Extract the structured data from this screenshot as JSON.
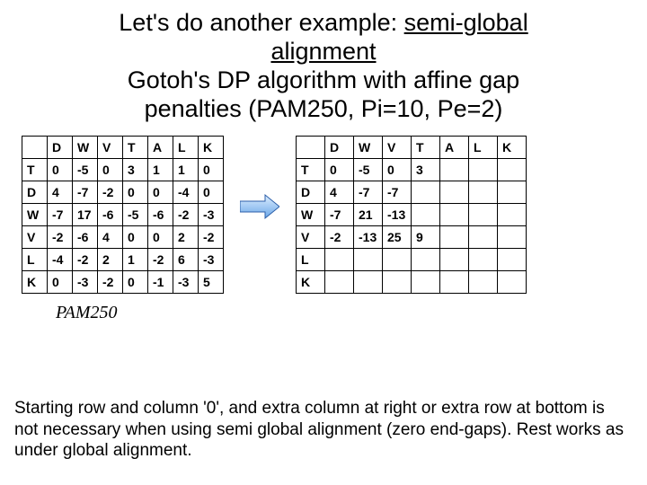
{
  "title": {
    "line1_pre": "Let's do another example: ",
    "line1_ul": "semi-global",
    "line2": "alignment",
    "line3": "Gotoh's DP algorithm with affine gap",
    "line4": "penalties (PAM250, Pi=10, Pe=2)"
  },
  "left_table": {
    "col_headers": [
      "D",
      "W",
      "V",
      "T",
      "A",
      "L",
      "K"
    ],
    "rows": [
      {
        "h": "T",
        "cells": [
          "0",
          "-5",
          "0",
          "3",
          "1",
          "1",
          "0"
        ]
      },
      {
        "h": "D",
        "cells": [
          "4",
          "-7",
          "-2",
          "0",
          "0",
          "-4",
          "0"
        ]
      },
      {
        "h": "W",
        "cells": [
          "-7",
          "17",
          "-6",
          "-5",
          "-6",
          "-2",
          "-3"
        ]
      },
      {
        "h": "V",
        "cells": [
          "-2",
          "-6",
          "4",
          "0",
          "0",
          "2",
          "-2"
        ]
      },
      {
        "h": "L",
        "cells": [
          "-4",
          "-2",
          "2",
          "1",
          "-2",
          "6",
          "-3"
        ]
      },
      {
        "h": "K",
        "cells": [
          "0",
          "-3",
          "-2",
          "0",
          "-1",
          "-3",
          "5"
        ]
      }
    ]
  },
  "right_table": {
    "col_headers": [
      "D",
      "W",
      "V",
      "T",
      "A",
      "L",
      "K"
    ],
    "rows": [
      {
        "h": "T",
        "cells": [
          "0",
          "-5",
          "0",
          "3",
          "",
          "",
          ""
        ]
      },
      {
        "h": "D",
        "cells": [
          "4",
          "-7",
          "-7",
          "",
          "",
          "",
          ""
        ]
      },
      {
        "h": "W",
        "cells": [
          "-7",
          "21",
          "-13",
          "",
          "",
          "",
          ""
        ]
      },
      {
        "h": "V",
        "cells": [
          "-2",
          "-13",
          "25",
          "9",
          "",
          "",
          ""
        ]
      },
      {
        "h": "L",
        "cells": [
          "",
          "",
          "",
          "",
          "",
          "",
          ""
        ]
      },
      {
        "h": "K",
        "cells": [
          "",
          "",
          "",
          "",
          "",
          "",
          ""
        ]
      }
    ]
  },
  "caption": "PAM250",
  "footer": "Starting row and column '0', and extra column at right or extra row at bottom is not necessary when using semi global alignment (zero end-gaps). Rest works as under global alignment.",
  "chart_data": [
    {
      "type": "table",
      "title": "PAM250 substitution scores (left matrix)",
      "columns": [
        "",
        "D",
        "W",
        "V",
        "T",
        "A",
        "L",
        "K"
      ],
      "rows": [
        [
          "T",
          0,
          -5,
          0,
          3,
          1,
          1,
          0
        ],
        [
          "D",
          4,
          -7,
          -2,
          0,
          0,
          -4,
          0
        ],
        [
          "W",
          -7,
          17,
          -6,
          -5,
          -6,
          -2,
          -3
        ],
        [
          "V",
          -2,
          -6,
          4,
          0,
          0,
          2,
          -2
        ],
        [
          "L",
          -4,
          -2,
          2,
          1,
          -2,
          6,
          -3
        ],
        [
          "K",
          0,
          -3,
          -2,
          0,
          -1,
          -3,
          5
        ]
      ]
    },
    {
      "type": "table",
      "title": "Gotoh DP matrix, semi-global, PAM250, Pi=10, Pe=2 (right matrix, partially filled)",
      "columns": [
        "",
        "D",
        "W",
        "V",
        "T",
        "A",
        "L",
        "K"
      ],
      "rows": [
        [
          "T",
          0,
          -5,
          0,
          3,
          null,
          null,
          null
        ],
        [
          "D",
          4,
          -7,
          -7,
          null,
          null,
          null,
          null
        ],
        [
          "W",
          -7,
          21,
          -13,
          null,
          null,
          null,
          null
        ],
        [
          "V",
          -2,
          -13,
          25,
          9,
          null,
          null,
          null
        ],
        [
          "L",
          null,
          null,
          null,
          null,
          null,
          null,
          null
        ],
        [
          "K",
          null,
          null,
          null,
          null,
          null,
          null,
          null
        ]
      ]
    }
  ]
}
